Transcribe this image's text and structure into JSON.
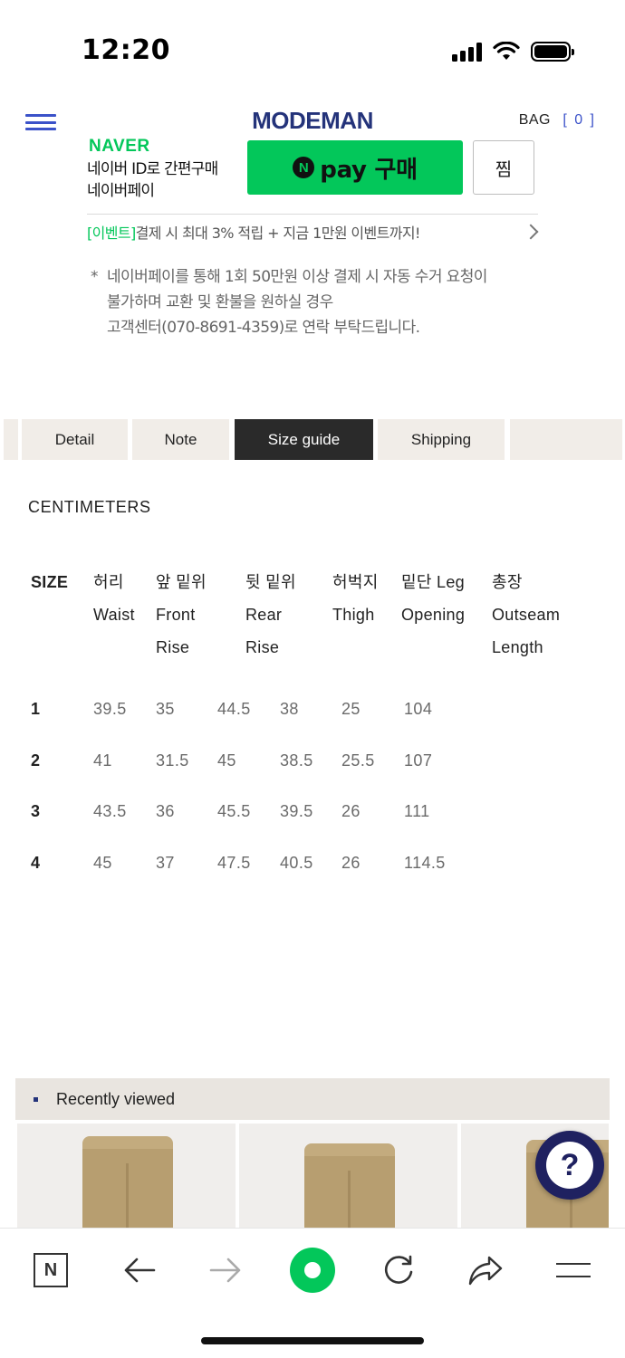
{
  "status_bar": {
    "time": "12:20"
  },
  "header": {
    "logo": "MODEMAN",
    "bag_label": "BAG",
    "bag_count": "[ 0 ]"
  },
  "naver_pay": {
    "brand": "NAVER",
    "desc_line1": "네이버 ID로 간편구매",
    "desc_line2": "네이버페이",
    "pay_n": "N",
    "pay_label": "pay 구매",
    "zzim_label": "찜",
    "event_tag": "[이벤트]",
    "event_text": "결제 시 최대 3% 적립 + 지금 1만원 이벤트까지!",
    "notice_star": "*",
    "notice_line1": "네이버페이를 통해 1회 50만원 이상 결제 시 자동 수거 요청이",
    "notice_line2": "불가하며 교환 및 환불을 원하실 경우",
    "notice_line3": "고객센터(070-8691-4359)로 연락 부탁드립니다."
  },
  "tabs": [
    {
      "label": "Detail"
    },
    {
      "label": "Note"
    },
    {
      "label": "Size guide"
    },
    {
      "label": "Shipping"
    }
  ],
  "active_tab": "Size guide",
  "size_guide": {
    "unit_title": "CENTIMETERS",
    "headers": [
      {
        "lines": [
          "SIZE"
        ]
      },
      {
        "lines": [
          "허리",
          "Waist"
        ]
      },
      {
        "lines": [
          "앞 밑위",
          "Front",
          "Rise"
        ]
      },
      {
        "lines": [
          "뒷 밑위",
          "Rear",
          "Rise"
        ]
      },
      {
        "lines": [
          "허벅지",
          "Thigh"
        ]
      },
      {
        "lines": [
          "밑단 Leg",
          "Opening"
        ]
      },
      {
        "lines": [
          "총장",
          "Outseam",
          "Length"
        ]
      }
    ],
    "rows": [
      [
        "1",
        "39.5",
        "35",
        "44.5",
        "38",
        "25",
        "104"
      ],
      [
        "2",
        "41",
        "31.5",
        "45",
        "38.5",
        "25.5",
        "107"
      ],
      [
        "3",
        "43.5",
        "36",
        "45.5",
        "39.5",
        "26",
        "111"
      ],
      [
        "4",
        "45",
        "37",
        "47.5",
        "40.5",
        "26",
        "114.5"
      ]
    ]
  },
  "recently_viewed": {
    "title": "Recently viewed"
  },
  "help_button": {
    "label": "?"
  },
  "toolbar": {
    "n_label": "N",
    "icons": [
      "naver-n-icon",
      "back-arrow-icon",
      "forward-arrow-icon",
      "green-dot-icon",
      "reload-icon",
      "share-icon",
      "menu-icon"
    ]
  },
  "colors": {
    "naver_green": "#03c75a",
    "brand_navy": "#24337a",
    "accent_blue": "#3b52c9",
    "tab_active_bg": "#2a2a2a",
    "tab_bg": "#f1ede8"
  }
}
